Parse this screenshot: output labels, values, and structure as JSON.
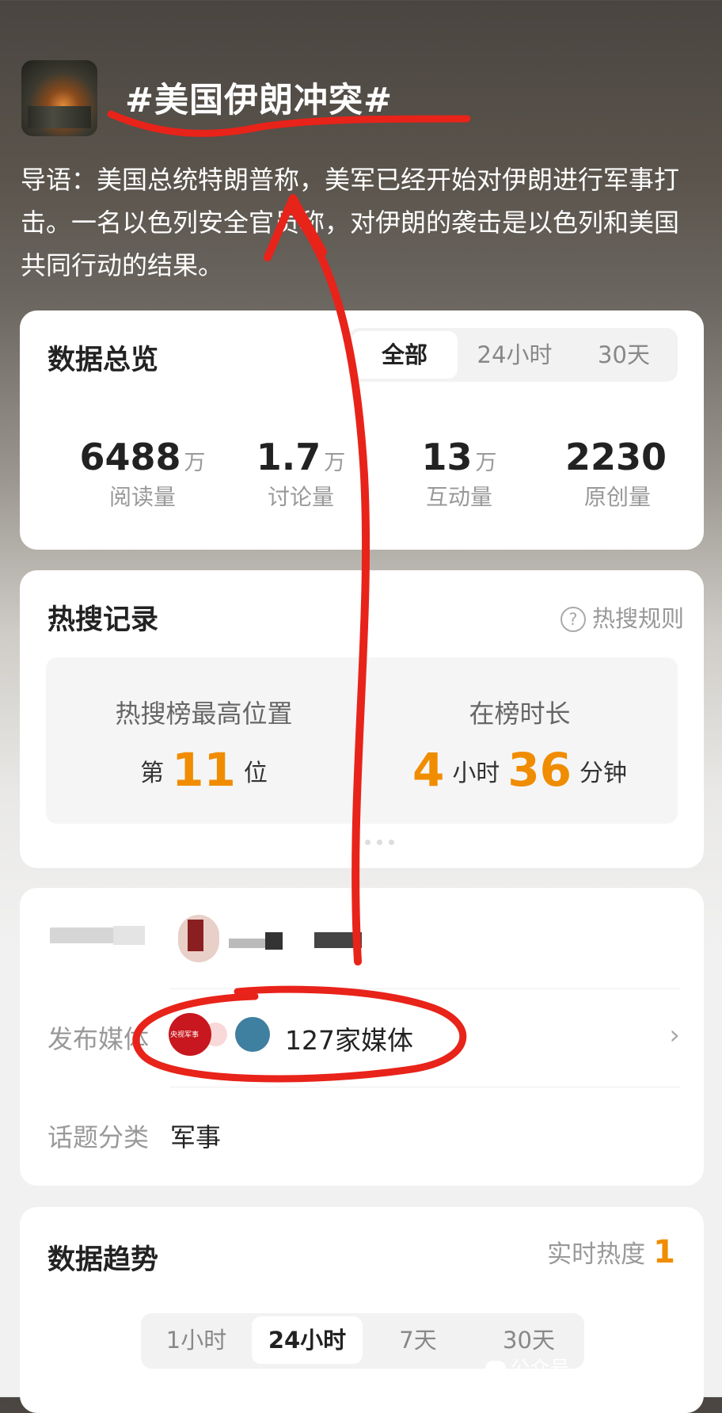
{
  "topic": {
    "title": "#美国伊朗冲突#",
    "intro": "导语：美国总统特朗普称，美军已经开始对伊朗进行军事打击。一名以色列安全官员称，对伊朗的袭击是以色列和美国共同行动的结果。"
  },
  "overview": {
    "title": "数据总览",
    "tabs": [
      "全部",
      "24小时",
      "30天"
    ],
    "active_tab": "全部",
    "stats": [
      {
        "value": "6488",
        "unit": "万",
        "label": "阅读量"
      },
      {
        "value": "1.7",
        "unit": "万",
        "label": "讨论量"
      },
      {
        "value": "13",
        "unit": "万",
        "label": "互动量"
      },
      {
        "value": "2230",
        "unit": "",
        "label": "原创量"
      }
    ]
  },
  "hot_search": {
    "title": "热搜记录",
    "rules_label": "热搜规则",
    "rules_icon": "?",
    "peak_label": "热搜榜最高位置",
    "peak_prefix": "第",
    "peak_value": "11",
    "peak_suffix": "位",
    "duration_label": "在榜时长",
    "duration_hours": "4",
    "duration_hours_unit": "小时",
    "duration_minutes": "36",
    "duration_minutes_unit": "分钟"
  },
  "info": {
    "media_label": "发布媒体",
    "media_count": "127家媒体",
    "media_logo_text": "央视军事",
    "chevron": "›",
    "category_label": "话题分类",
    "category_value": "军事"
  },
  "trend": {
    "title": "数据趋势",
    "realtime_label": "实时热度",
    "realtime_value": "1",
    "tabs": [
      "1小时",
      "24小时",
      "7天",
      "30天"
    ],
    "active_tab": "24小时"
  },
  "watermark": "公众号 · 新青年1919",
  "colors": {
    "accent_orange": "#f08c00",
    "annotation_red": "#e8231a"
  }
}
